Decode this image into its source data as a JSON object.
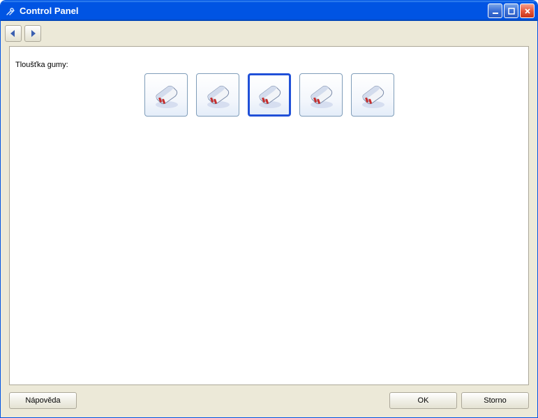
{
  "window": {
    "title": "Control Panel"
  },
  "content": {
    "label": "Tloušťka gumy:"
  },
  "eraser_options": [
    {
      "id": "eraser-1",
      "selected": false
    },
    {
      "id": "eraser-2",
      "selected": false
    },
    {
      "id": "eraser-3",
      "selected": true
    },
    {
      "id": "eraser-4",
      "selected": false
    },
    {
      "id": "eraser-5",
      "selected": false
    }
  ],
  "buttons": {
    "help": "Nápověda",
    "ok": "OK",
    "cancel": "Storno"
  }
}
